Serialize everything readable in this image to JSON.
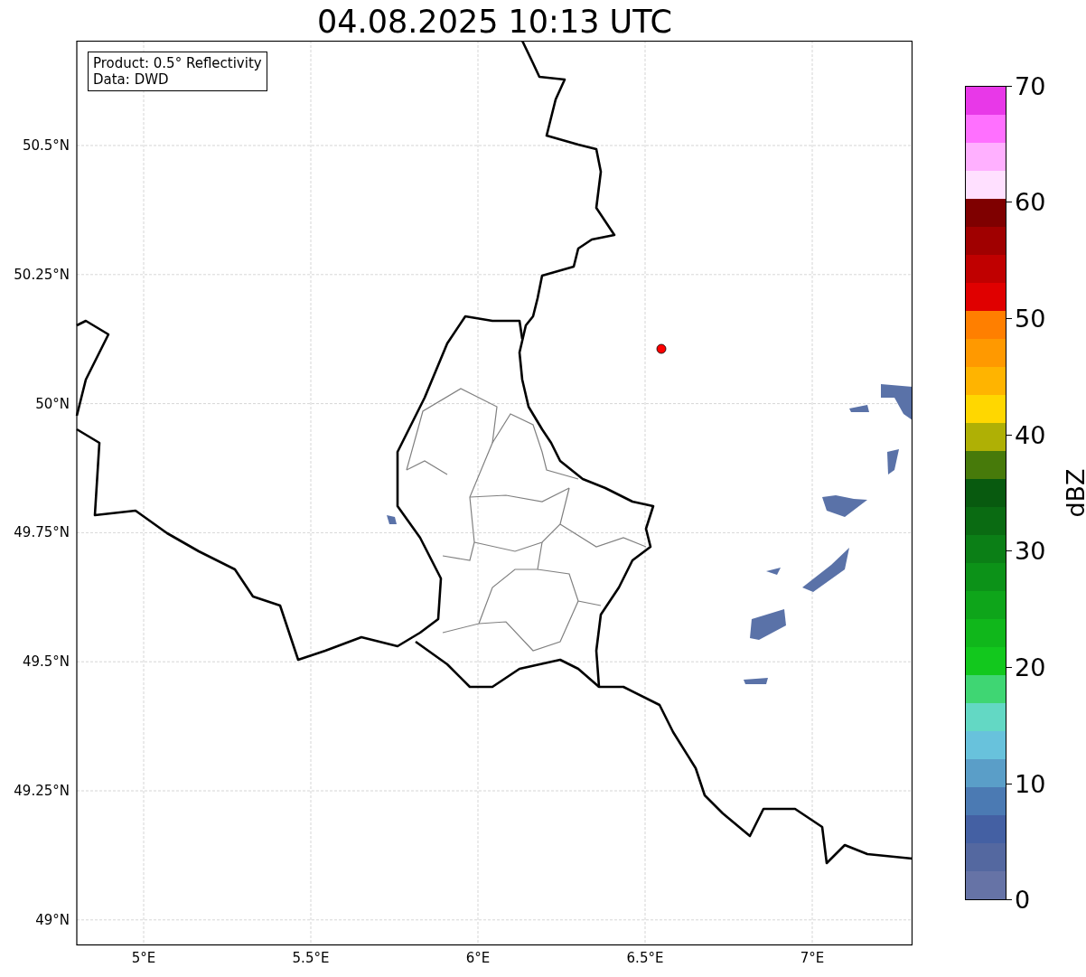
{
  "title": "04.08.2025 10:13 UTC",
  "info_box": [
    "Product: 0.5° Reflectivity",
    "Data: DWD"
  ],
  "map": {
    "x_ticks": [
      "5°E",
      "5.5°E",
      "6°E",
      "6.5°E",
      "7°E"
    ],
    "y_ticks": [
      "50.5°N",
      "50.25°N",
      "50°N",
      "49.75°N",
      "49.5°N",
      "49.25°N",
      "49°N"
    ]
  },
  "colorbar": {
    "label": "dBZ",
    "ticks": [
      "70",
      "60",
      "50",
      "40",
      "30",
      "20",
      "10",
      "0"
    ],
    "segments": [
      {
        "color": "#e838e8"
      },
      {
        "color": "#ff70ff"
      },
      {
        "color": "#ffb0ff"
      },
      {
        "color": "#ffe0ff"
      },
      {
        "color": "#7f0000"
      },
      {
        "color": "#a00000"
      },
      {
        "color": "#c00000"
      },
      {
        "color": "#e00000"
      },
      {
        "color": "#ff7f00"
      },
      {
        "color": "#ff9900"
      },
      {
        "color": "#ffb400"
      },
      {
        "color": "#ffd700"
      },
      {
        "color": "#afb005"
      },
      {
        "color": "#477a0a"
      },
      {
        "color": "#085a0f"
      },
      {
        "color": "#0a6b12"
      },
      {
        "color": "#0b7f16"
      },
      {
        "color": "#0c9218"
      },
      {
        "color": "#0ea51a"
      },
      {
        "color": "#10b71b"
      },
      {
        "color": "#12c81d"
      },
      {
        "color": "#3fd673"
      },
      {
        "color": "#63d8c4"
      },
      {
        "color": "#68c2dc"
      },
      {
        "color": "#5a9ec8"
      },
      {
        "color": "#4b7ab3"
      },
      {
        "color": "#4460a3"
      },
      {
        "color": "#5468a0"
      },
      {
        "color": "#6673a6"
      }
    ]
  }
}
